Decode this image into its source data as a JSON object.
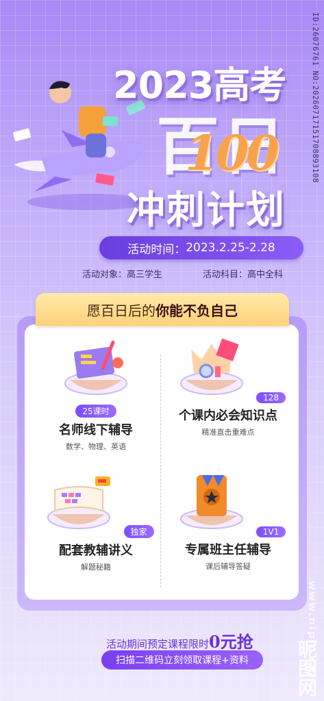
{
  "side_id": "ID:26076761 NO:20260717151708893108",
  "watermark": "www.nipic.cn",
  "logo_text": "昵图网",
  "hero": {
    "title_year": "2023高考",
    "title_days_cn": "百日",
    "title_days_num": "100",
    "title_plan": "冲刺计划"
  },
  "event": {
    "time_label": "活动时间：",
    "time_value": "2023.2.25-2.28",
    "target_label": "活动对象：",
    "target_value": "高三学生",
    "subject_label": "活动科目：",
    "subject_value": "高中全科"
  },
  "card": {
    "header_prefix": "愿百日后的",
    "header_emph": "你能不负自己",
    "features": [
      {
        "badge": "25课时",
        "title": "名师线下辅导",
        "sub": "数学、物理、英语",
        "icon": "book-pencil-icon"
      },
      {
        "badge": "128",
        "title": "个课内必会知识点",
        "sub": "精准直击重难点",
        "icon": "crown-blocks-icon"
      },
      {
        "badge": "独家",
        "title": "配套教辅讲义",
        "sub": "解题秘籍",
        "icon": "open-book-icon"
      },
      {
        "badge": "1V1",
        "title": "专属班主任辅导",
        "sub": "课后辅导答疑",
        "icon": "star-badge-icon"
      }
    ]
  },
  "promo": {
    "text": "活动期间预定课程限时",
    "highlight": "0元抢",
    "cta": "扫描二维码立刻领取课程+资料"
  },
  "colors": {
    "accent": "#7c4dff",
    "header_gold": "#ffd27a",
    "number_orange": "#f6a34c"
  }
}
